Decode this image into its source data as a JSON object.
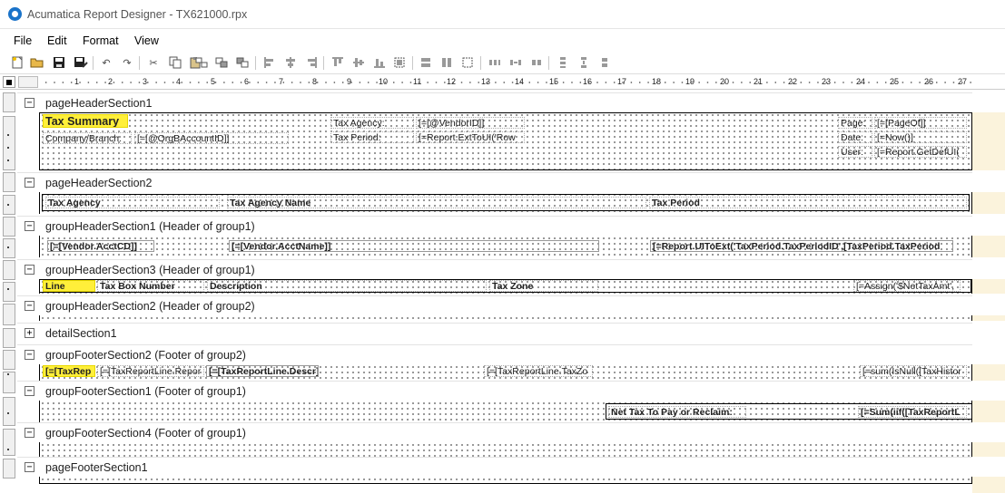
{
  "window": {
    "title": "Acumatica Report Designer - TX621000.rpx"
  },
  "menu": [
    "File",
    "Edit",
    "Format",
    "View"
  ],
  "toolbar": {
    "icons": [
      "new-icon",
      "open-icon",
      "save-icon",
      "save-as-icon",
      "undo-icon",
      "redo-icon",
      "cut-icon",
      "copy-icon",
      "paste-icon",
      "delete-icon",
      "copy-format-icon",
      "align-left-icon",
      "align-center-icon",
      "align-right-icon",
      "align-top-icon",
      "align-middle-icon",
      "align-bottom-icon",
      "same-width-icon",
      "same-height-icon",
      "same-size-icon",
      "hspace-equal-icon",
      "hspace-increase-icon",
      "hspace-decrease-icon",
      "vspace-equal-icon",
      "vspace-increase-icon",
      "vspace-decrease-icon"
    ]
  },
  "ruler": {
    "ticks": [
      "1",
      "2",
      "3",
      "4",
      "5",
      "6",
      "7",
      "8",
      "9",
      "10",
      "11",
      "12",
      "13",
      "14",
      "15",
      "16",
      "17",
      "18",
      "19",
      "20",
      "21",
      "22",
      "23",
      "24",
      "25",
      "26",
      "27"
    ]
  },
  "sections": {
    "ph1": {
      "name": "pageHeaderSection1",
      "exp": "−"
    },
    "ph2": {
      "name": "pageHeaderSection2",
      "exp": "−"
    },
    "gh1": {
      "name": "groupHeaderSection1 (Header of group1)",
      "exp": "−"
    },
    "gh3": {
      "name": "groupHeaderSection3 (Header of group1)",
      "exp": "−"
    },
    "gh2": {
      "name": "groupHeaderSection2 (Header of group2)",
      "exp": "−"
    },
    "det": {
      "name": "detailSection1",
      "exp": "+"
    },
    "gf2": {
      "name": "groupFooterSection2 (Footer of group2)",
      "exp": "−"
    },
    "gf1": {
      "name": "groupFooterSection1 (Footer of group1)",
      "exp": "−"
    },
    "gf4": {
      "name": "groupFooterSection4 (Footer of group1)",
      "exp": "−"
    },
    "pf1": {
      "name": "pageFooterSection1",
      "exp": "−"
    }
  },
  "ph1": {
    "title": "Tax Summary",
    "company": "Company/Branch:",
    "company_val": "[=[@OrgBAccountID]]",
    "agency": "Tax Agency:",
    "agency_val": "[=[@VendorID]]",
    "period": "Tax Period:",
    "period_val": "[=Report.ExtToUI('Row",
    "page": "Page:",
    "page_val": "[=[PageOf]]",
    "date": "Date:",
    "date_val": "[=Now()]",
    "user": "User:",
    "user_val": "[=Report.GetDefUI("
  },
  "ph2": {
    "agency": "Tax Agency",
    "agency_name": "Tax Agency Name",
    "period": "Tax Period"
  },
  "gh1": {
    "acct": "[=[Vendor.AcctCD]]",
    "name": "[=[Vendor.AcctName]]",
    "period": "[=Report.UIToExt('TaxPeriod.TaxPeriodID',[TaxPeriod.TaxPeriod"
  },
  "gh3": {
    "line": "Line",
    "box": "Tax Box Number",
    "desc": "Description",
    "zone": "Tax Zone",
    "assign": "[=Assign('$NetTaxAmt',"
  },
  "gf2": {
    "f1": "[=[TaxRep",
    "f2": "[=[TaxReportLine.Repor",
    "f3": "[=[TaxReportLine.Descr]]",
    "f4": "[=[TaxReportLine.TaxZo",
    "f5": "[=sum(IsNull([TaxHistor"
  },
  "gf1": {
    "label": "Net Tax To Pay or Reclaim:",
    "val": "[=Sum(iif([TaxReportL"
  }
}
